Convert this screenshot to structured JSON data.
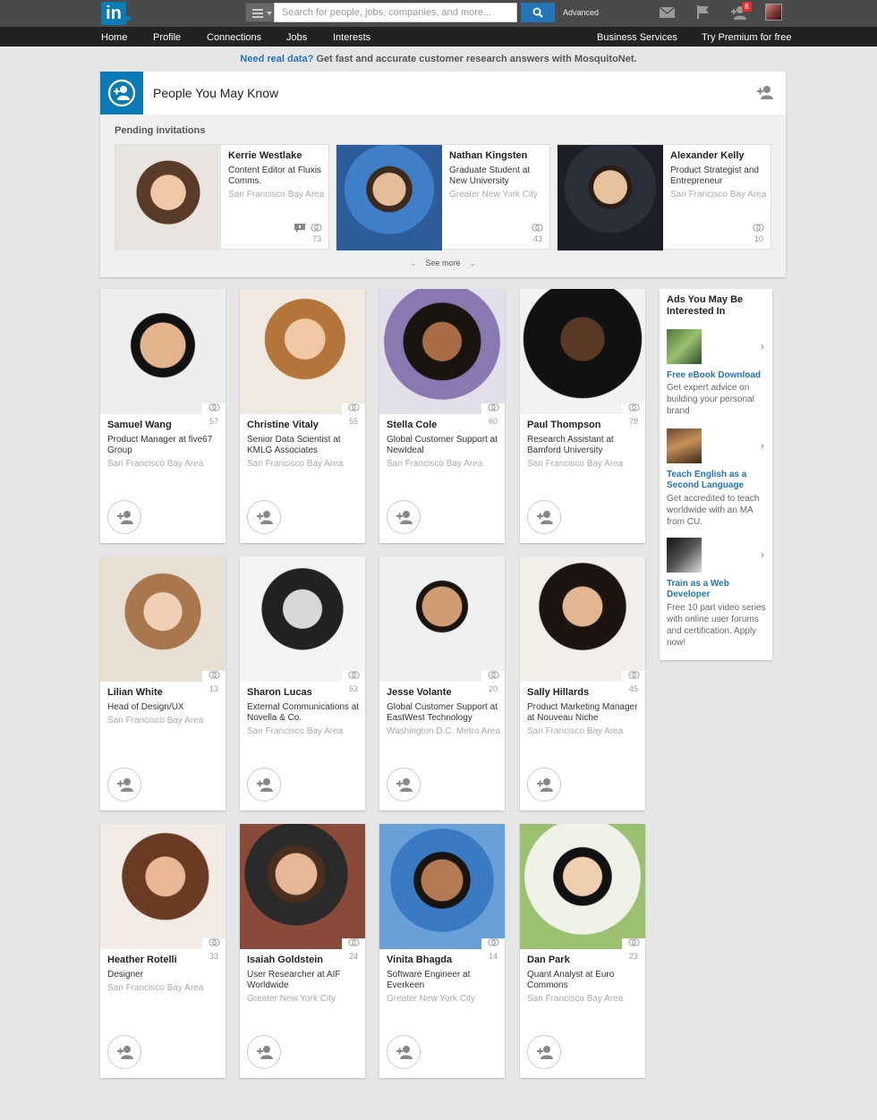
{
  "topbar": {
    "logo_text": "in",
    "search_placeholder": "Search for people, jobs, companies, and more...",
    "advanced_label": "Advanced",
    "notification_count": "8"
  },
  "nav": {
    "left": [
      "Home",
      "Profile",
      "Connections",
      "Jobs",
      "Interests"
    ],
    "business": "Business Services",
    "premium": "Try Premium for free"
  },
  "promo": {
    "link": "Need real data?",
    "text": " Get fast and accurate customer research answers with MosquitoNet."
  },
  "pymk": {
    "title": "People You May Know",
    "pending_label": "Pending invitations",
    "see_more": "See more"
  },
  "invitations": [
    {
      "name": "Kerrie Westlake",
      "title": "Content Editor at Fluxis Comms.",
      "location": "San Francisco Bay Area",
      "count": "73"
    },
    {
      "name": "Nathan Kingsten",
      "title": "Graduate Student at New University",
      "location": "Greater New York City",
      "count": "43"
    },
    {
      "name": "Alexander Kelly",
      "title": "Product Strategist and Entrepreneur",
      "location": "San Francisco Bay Area",
      "count": "10"
    }
  ],
  "people": [
    {
      "name": "Samuel Wang",
      "title": "Product Manager at five67 Group",
      "location": "San Francisco Bay Area",
      "count": "57"
    },
    {
      "name": "Christine Vitaly",
      "title": "Senior Data Scientist at KMLG Associates",
      "location": "San Francisco Bay Area",
      "count": "55"
    },
    {
      "name": "Stella Cole",
      "title": "Global Customer Support at NewIdeal",
      "location": "San Francisco Bay Area",
      "count": "60"
    },
    {
      "name": "Paul Thompson",
      "title": "Research Assistant at Bamford University",
      "location": "San Francisco Bay Area",
      "count": "78"
    },
    {
      "name": "Lilian White",
      "title": "Head of Design/UX",
      "location": "San Francisco Bay Area",
      "count": "13"
    },
    {
      "name": "Sharon Lucas",
      "title": "External Communications at Novella & Co.",
      "location": "San Francisco Bay Area",
      "count": "63"
    },
    {
      "name": "Jesse Volante",
      "title": "Global Customer Support at EastWest Technology",
      "location": "Washington D.C. Metro Area",
      "count": "20"
    },
    {
      "name": "Sally Hillards",
      "title": "Product Marketing Manager at Nouveau Niche",
      "location": "San Francisco Bay Area",
      "count": "45"
    },
    {
      "name": "Heather Rotelli",
      "title": "Designer",
      "location": "San Francisco Bay Area",
      "count": "33"
    },
    {
      "name": "Isaiah Goldstein",
      "title": "User Researcher at AIF Worldwide",
      "location": "Greater New York City",
      "count": "24"
    },
    {
      "name": "Vinita Bhagda",
      "title": "Software Engineer at Everkeen",
      "location": "Greater New York City",
      "count": "14"
    },
    {
      "name": "Dan Park",
      "title": "Quant Analyst at Euro Commons",
      "location": "San Francisco Bay Area",
      "count": "23"
    }
  ],
  "ads": {
    "title": "Ads You May Be Interested In",
    "items": [
      {
        "headline": "Free eBook Download",
        "body": "Get expert advice on building your personal brand"
      },
      {
        "headline": "Teach English as a Second Language",
        "body": "Get accredited to teach worldwide with an MA from CU."
      },
      {
        "headline": "Train as a Web Developer",
        "body": "Free 10 part video series with online user forums and certification. Apply now!"
      }
    ]
  },
  "colors": {
    "brand": "#0b7bb5",
    "link": "#2275b7",
    "badge": "#e0322c"
  }
}
